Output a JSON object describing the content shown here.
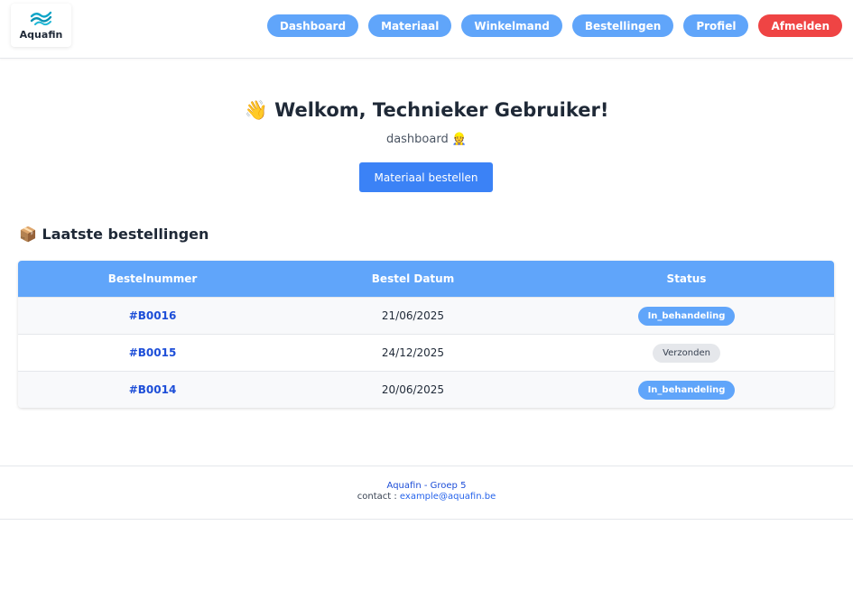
{
  "brand": {
    "name": "Aquafin",
    "logo_icon": "aquafin-waves-logo"
  },
  "nav": {
    "items": [
      {
        "label": "Dashboard"
      },
      {
        "label": "Materiaal"
      },
      {
        "label": "Winkelmand"
      },
      {
        "label": "Bestellingen"
      },
      {
        "label": "Profiel"
      }
    ],
    "logout_label": "Afmelden"
  },
  "welcome": {
    "wave_emoji": "👋",
    "title": "Welkom, Technieker Gebruiker!",
    "subtitle": "dashboard",
    "subtitle_emoji": "👷",
    "cta_label": "Materiaal bestellen"
  },
  "orders": {
    "section_emoji": "📦",
    "title": "Laatste bestellingen",
    "columns": [
      "Bestelnummer",
      "Bestel Datum",
      "Status"
    ],
    "rows": [
      {
        "number": "#B0016",
        "date": "21/06/2025",
        "status": "In_behandeling"
      },
      {
        "number": "#B0015",
        "date": "24/12/2025",
        "status": "Verzonden"
      },
      {
        "number": "#B0014",
        "date": "20/06/2025",
        "status": "In_behandeling"
      }
    ]
  },
  "footer": {
    "brand_line": "Aquafin - Groep 5",
    "contact_label": "contact :",
    "contact_email": "example@aquafin.be"
  },
  "colors": {
    "accent": "#60a5fa",
    "primary": "#3b82f6",
    "danger": "#ef4444",
    "link": "#1d4ed8"
  }
}
